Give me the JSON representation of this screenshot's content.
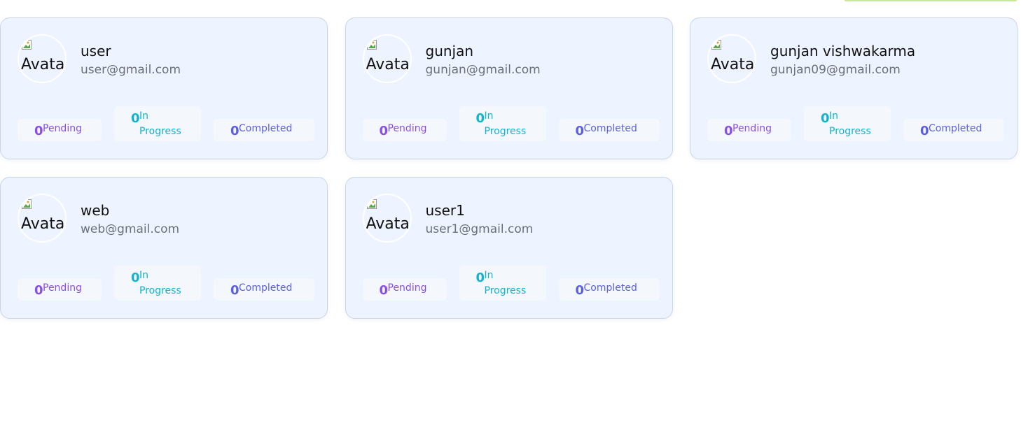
{
  "avatar_alt": "Avatar",
  "stat_labels": {
    "pending": "Pending",
    "in_progress_line1": "In",
    "in_progress_line2": "Progress",
    "completed": "Completed"
  },
  "users": [
    {
      "name": "user",
      "email": "user@gmail.com",
      "pending": "0",
      "in_progress": "0",
      "completed": "0"
    },
    {
      "name": "gunjan",
      "email": "gunjan@gmail.com",
      "pending": "0",
      "in_progress": "0",
      "completed": "0"
    },
    {
      "name": "gunjan vishwakarma",
      "email": "gunjan09@gmail.com",
      "pending": "0",
      "in_progress": "0",
      "completed": "0"
    },
    {
      "name": "web",
      "email": "web@gmail.com",
      "pending": "0",
      "in_progress": "0",
      "completed": "0"
    },
    {
      "name": "user1",
      "email": "user1@gmail.com",
      "pending": "0",
      "in_progress": "0",
      "completed": "0"
    }
  ],
  "colors": {
    "card_bg": "#eef4ff",
    "pending": "#8a4fe6",
    "in_progress": "#12b3cd",
    "completed": "#5b5fe0"
  }
}
